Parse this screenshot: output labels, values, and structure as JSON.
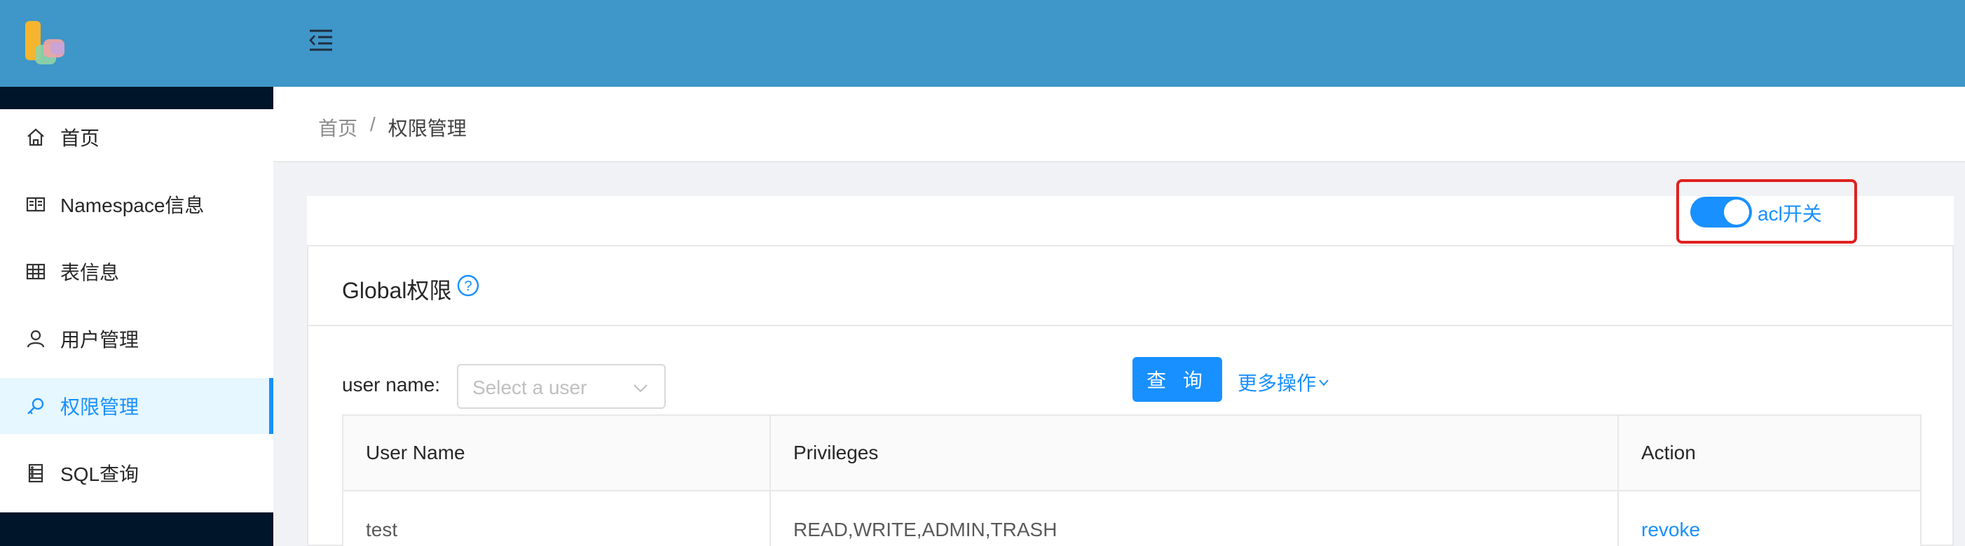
{
  "colors": {
    "header": "#3f96c8",
    "accent": "#1890ff",
    "sider_dark": "#001529",
    "highlight_box": "#e02020"
  },
  "sidebar": {
    "items": [
      {
        "label": "首页",
        "icon": "home-icon"
      },
      {
        "label": "Namespace信息",
        "icon": "book-icon"
      },
      {
        "label": "表信息",
        "icon": "table-icon"
      },
      {
        "label": "用户管理",
        "icon": "user-icon"
      },
      {
        "label": "权限管理",
        "icon": "key-icon",
        "active": true
      },
      {
        "label": "SQL查询",
        "icon": "database-icon"
      }
    ]
  },
  "header": {
    "fold_icon": "menu-fold-icon"
  },
  "breadcrumb": {
    "home": "首页",
    "separator": "/",
    "current": "权限管理"
  },
  "acl": {
    "label": "acl开关",
    "enabled": true
  },
  "card": {
    "title": "Global权限",
    "filter": {
      "label": "user name",
      "placeholder": "Select a user"
    },
    "query_button": "查 询",
    "more_actions": "更多操作"
  },
  "table": {
    "columns": [
      "User Name",
      "Privileges",
      "Action"
    ],
    "rows": [
      {
        "user": "test",
        "privileges": "READ,WRITE,ADMIN,TRASH",
        "action": "revoke"
      }
    ]
  }
}
